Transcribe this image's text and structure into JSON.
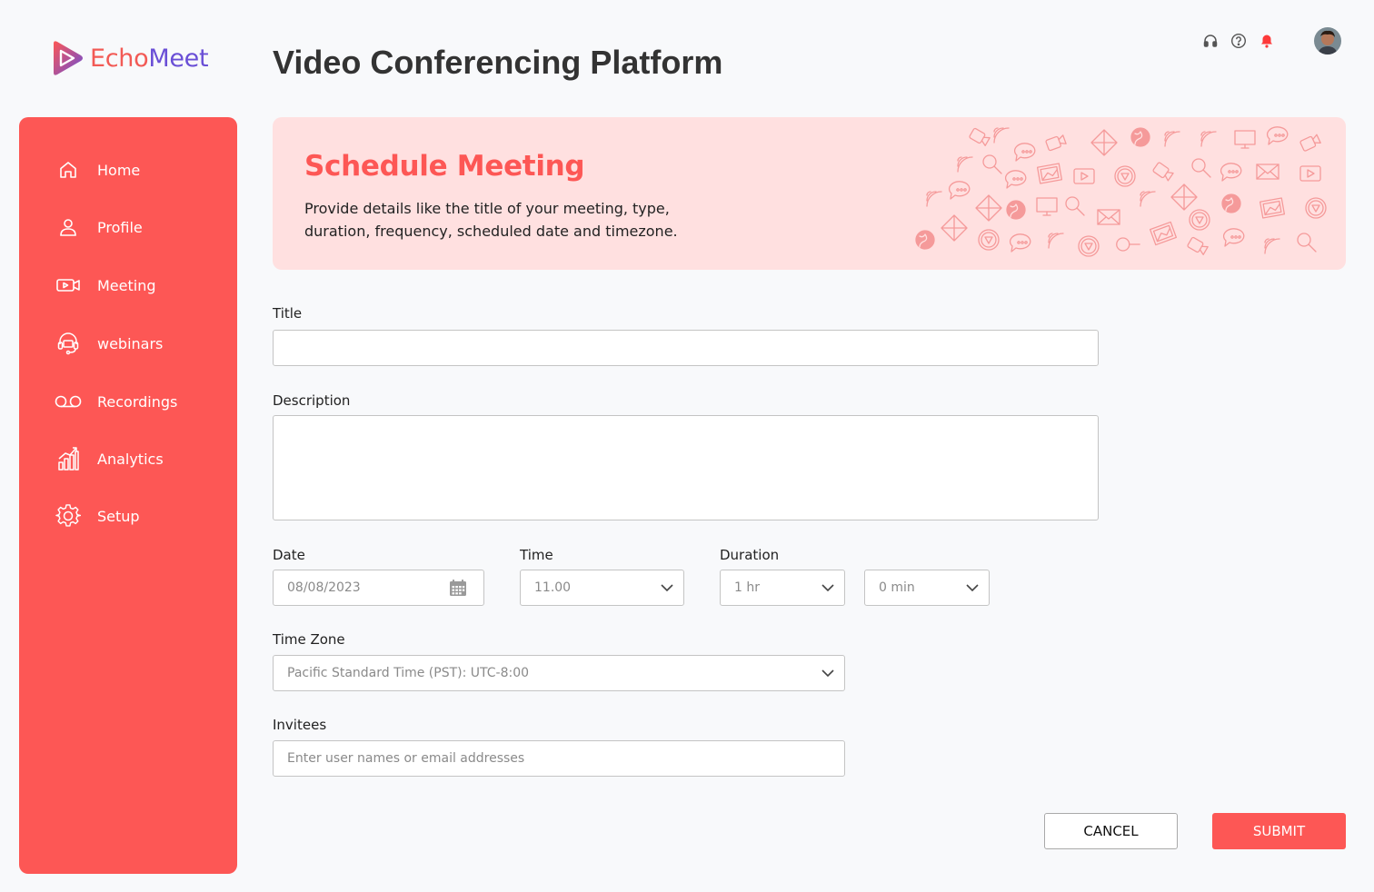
{
  "brand": {
    "name_part1": "Echo",
    "name_part2": "Meet",
    "primary": "#fd5755",
    "secondary": "#6a4fd6"
  },
  "page": {
    "title": "Video Conferencing Platform"
  },
  "header_icons": [
    "headset-icon",
    "help-icon",
    "bell-icon"
  ],
  "sidebar": {
    "items": [
      {
        "label": "Home",
        "icon": "home-icon"
      },
      {
        "label": "Profile",
        "icon": "user-icon"
      },
      {
        "label": "Meeting",
        "icon": "video-camera-icon"
      },
      {
        "label": "webinars",
        "icon": "webinar-headset-icon"
      },
      {
        "label": "Recordings",
        "icon": "voicemail-icon"
      },
      {
        "label": "Analytics",
        "icon": "bar-chart-icon"
      },
      {
        "label": "Setup",
        "icon": "gear-icon"
      }
    ]
  },
  "banner": {
    "title": "Schedule Meeting",
    "description": "Provide details like the title of your meeting, type, duration, frequency, scheduled date and timezone.",
    "bg_color": "#ffe0e0"
  },
  "form": {
    "title": {
      "label": "Title",
      "value": ""
    },
    "description": {
      "label": "Description",
      "value": ""
    },
    "date": {
      "label": "Date",
      "value": "08/08/2023"
    },
    "time": {
      "label": "Time",
      "value": "11.00"
    },
    "duration": {
      "label": "Duration",
      "hours": "1 hr",
      "minutes": "0 min"
    },
    "timezone": {
      "label": "Time Zone",
      "value": "Pacific Standard Time (PST): UTC-8:00"
    },
    "invitees": {
      "label": "Invitees",
      "placeholder": "Enter user names or email addresses"
    }
  },
  "actions": {
    "cancel_label": "CANCEL",
    "submit_label": "SUBMIT"
  }
}
